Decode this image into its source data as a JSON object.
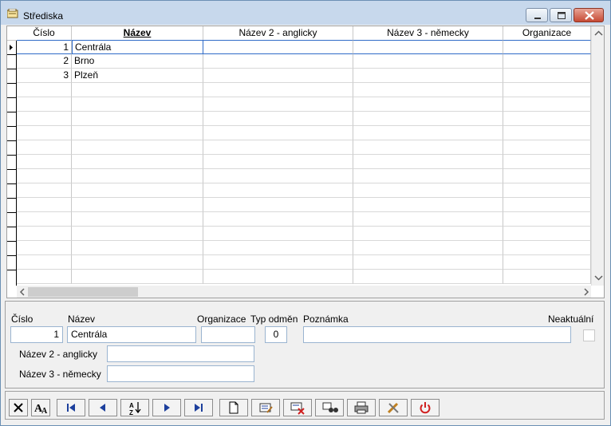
{
  "window": {
    "title": "Střediska"
  },
  "grid": {
    "columns": [
      {
        "label": "Číslo"
      },
      {
        "label": "Název"
      },
      {
        "label": "Název 2 - anglicky"
      },
      {
        "label": "Název 3 - německy"
      },
      {
        "label": "Organizace"
      }
    ],
    "rows": [
      {
        "cislo": "1",
        "nazev": "Centrála"
      },
      {
        "cislo": "2",
        "nazev": "Brno"
      },
      {
        "cislo": "3",
        "nazev": "Plzeň"
      }
    ]
  },
  "form": {
    "cislo_label": "Číslo",
    "cislo_value": "1",
    "nazev_label": "Název",
    "nazev_value": "Centrála",
    "organizace_label": "Organizace",
    "organizace_value": "",
    "typ_odmen_label": "Typ odměn",
    "typ_odmen_value": "0",
    "poznamka_label": "Poznámka",
    "poznamka_value": "",
    "neaktualni_label": "Neaktuální",
    "neaktualni_checked": false,
    "nazev2_label": "Název 2 - anglicky",
    "nazev2_value": "",
    "nazev3_label": "Název 3 - německy",
    "nazev3_value": ""
  },
  "toolbar": {
    "buttons": [
      "close-icon",
      "font-icon",
      "first-record-icon",
      "previous-record-icon",
      "sort-az-icon",
      "next-record-icon",
      "last-record-icon",
      "new-record-icon",
      "edit-record-icon",
      "delete-record-icon",
      "find-icon",
      "print-icon",
      "tools-icon",
      "power-icon"
    ]
  },
  "colors": {
    "titlebar": "#c7d8ec",
    "close_button": "#c64a34",
    "selection_border": "#2f6bc8"
  }
}
